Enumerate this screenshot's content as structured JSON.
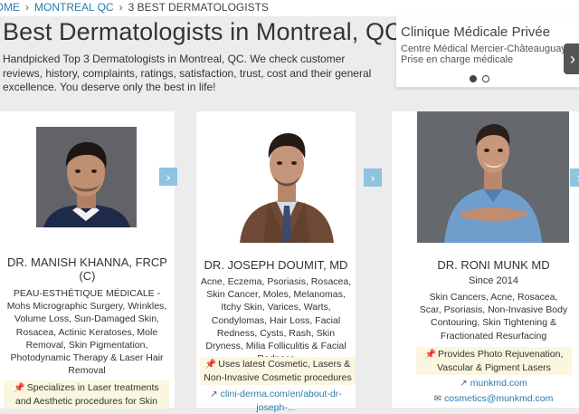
{
  "breadcrumb": {
    "home": "HOME",
    "city": "MONTREAL QC",
    "current": "3 BEST DERMATOLOGISTS",
    "separator": "›"
  },
  "page": {
    "title": "Best Dermatologists in Montreal, QC",
    "intro": "Handpicked Top 3 Dermatologists in Montreal, QC. We check customer reviews, history, complaints, ratings, satisfaction, trust, cost and their general excellence. You deserve only the best in life!"
  },
  "ad": {
    "title": "Clinique Médicale Privée",
    "line1": "Centre Médical Mercier-Châteauguay",
    "line2": "Prise en charge médicale",
    "next_icon": "›"
  },
  "doctors": [
    {
      "name": "DR. MANISH KHANNA, FRCP (C)",
      "specialties": "PEAU-ESTHÉTIQUE MÉDICALE - Mohs Micrographic Surgery, Wrinkles, Volume Loss, Sun-Damaged Skin, Rosacea, Actinic Keratoses, Mole Removal, Skin Pigmentation, Photodynamic Therapy & Laser Hair Removal",
      "highlight": "Specializes in Laser treatments and Aesthetic procedures for Skin",
      "next_icon": "›"
    },
    {
      "name": "DR. JOSEPH DOUMIT, MD",
      "specialties": "Acne, Eczema, Psoriasis, Rosacea, Skin Cancer, Moles, Melanomas, Itchy Skin, Varices, Warts, Condylomas, Hair Loss, Facial Redness, Cysts, Rash, Skin Dryness, Milia Folliculitis & Facial Redness",
      "highlight": "Uses latest Cosmetic, Lasers & Non-Invasive Cosmetic procedures",
      "website": "clini-derma.com/en/about-dr-joseph-...",
      "next_icon": "›"
    },
    {
      "name": "DR. RONI MUNK MD",
      "since": "Since 2014",
      "specialties": "Skin Cancers, Acne, Rosacea, Scar, Psoriasis, Non-Invasive Body Contouring, Skin Tightening & Fractionated Resurfacing",
      "highlight": "Provides Photo Rejuvenation, Vascular & Pigment Lasers",
      "website": "munkmd.com",
      "email": "cosmetics@munkmd.com",
      "next_icon": "›"
    }
  ],
  "icons": {
    "pin": "pin-icon",
    "link": "external-link-icon",
    "mail": "mail-icon"
  },
  "colors": {
    "link": "#2a7ab0",
    "highlight_bg": "#fbf6df",
    "arrow_bg": "#8fc3e0",
    "page_bg": "#ececec"
  }
}
